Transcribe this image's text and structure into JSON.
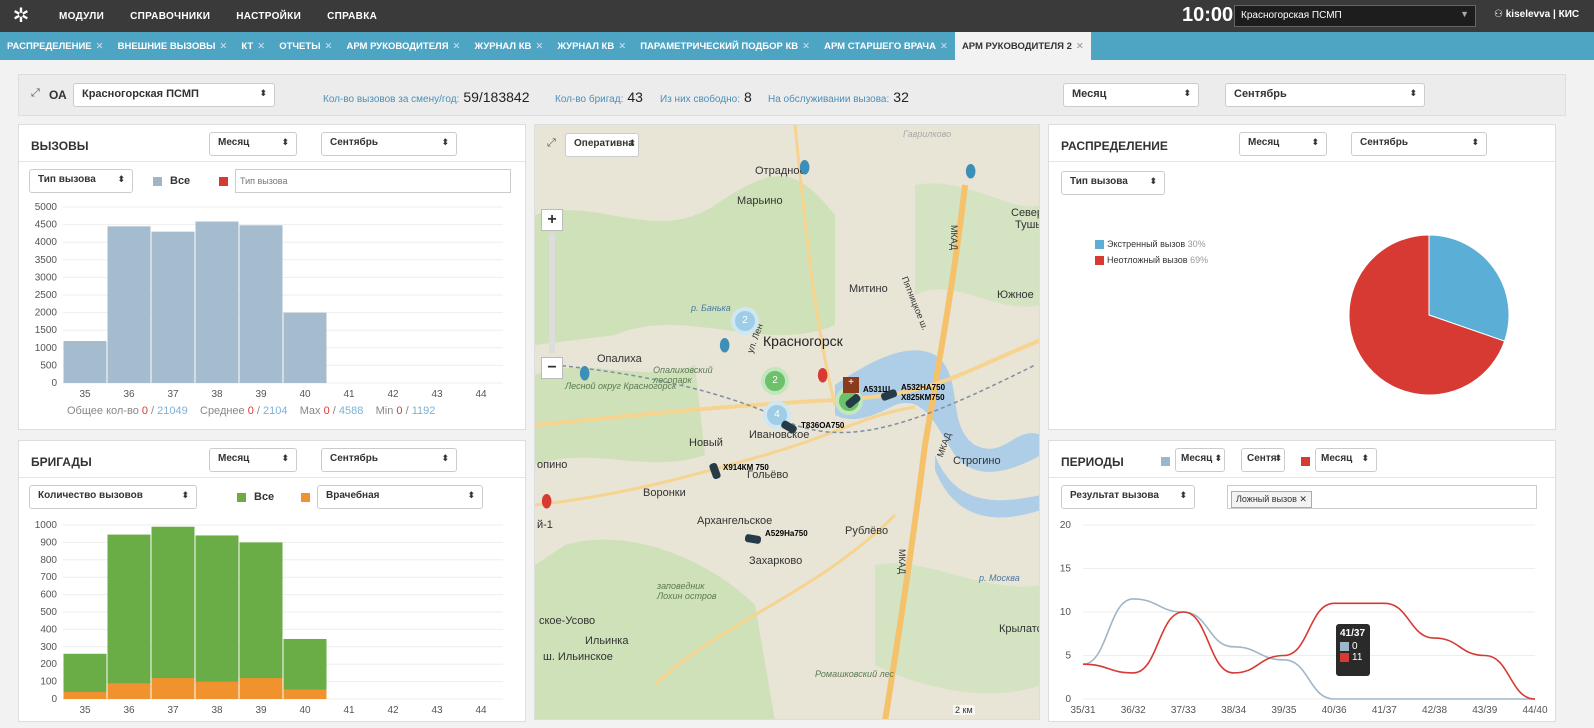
{
  "topbar": {
    "menu": [
      "МОДУЛИ",
      "СПРАВОЧНИКИ",
      "НАСТРОЙКИ",
      "СПРАВКА"
    ],
    "time": "10:00",
    "org": "Красногорская ПСМП",
    "user": "kiselevva | КИС"
  },
  "tabs": [
    "РАСПРЕДЕЛЕНИЕ",
    "ВНЕШНИЕ ВЫЗОВЫ",
    "КТ",
    "ОТЧЕТЫ",
    "АРМ РУКОВОДИТЕЛЯ",
    "ЖУРНАЛ КВ",
    "ЖУРНАЛ КВ",
    "ПАРАМЕТРИЧЕСКИЙ ПОДБОР КВ",
    "АРМ СТАРШЕГО ВРАЧА",
    "АРМ РУКОВОДИТЕЛЯ 2"
  ],
  "oabar": {
    "label": "ОА",
    "org": "Красногорская ПСМП",
    "calls_label": "Кол-во вызовов за смену/год:",
    "calls": "59/183842",
    "brigades_label": "Кол-во бригад:",
    "brigades": "43",
    "free_label": "Из них свободно:",
    "free": "8",
    "busy_label": "На обслуживании вызова:",
    "busy": "32",
    "period": "Месяц",
    "month": "Сентябрь"
  },
  "calls": {
    "title": "ВЫЗОВЫ",
    "period": "Месяц",
    "month": "Сентябрь",
    "type": "Тип вызова",
    "legend_all": "Все",
    "filter_placeholder": "Тип вызова",
    "summary": {
      "total_label": "Общее кол-во",
      "total_a": "0",
      "total_b": "21049",
      "avg_label": "Среднее",
      "avg_a": "0",
      "avg_b": "2104",
      "max_label": "Max",
      "max_a": "0",
      "max_b": "4588",
      "min_label": "Min",
      "min_a": "0",
      "min_b": "1192"
    }
  },
  "brigades": {
    "title": "БРИГАДЫ",
    "period": "Месяц",
    "month": "Сентябрь",
    "type": "Количество вызовов",
    "legend_all": "Все",
    "legend_doc": "Врачебная"
  },
  "map": {
    "mode": "Оперативна",
    "labels": {
      "otradnoe": "Отрадное",
      "marino": "Марьино",
      "sever": "Север",
      "tush": "Тушь",
      "mitino": "Митино",
      "yuzhnoe": "Южное",
      "krasnogorsk": "Красногорск",
      "opaliha": "Опалиха",
      "lesopark": "Опалиховский лесопарк",
      "okrug": "Лесной округ Красногорск",
      "banka": "р. Банька",
      "novy": "Новый",
      "ivanovskoe": "Ивановское",
      "golevo": "Гольёво",
      "voronki": "Воронки",
      "arkh": "Архангельское",
      "rublevo": "Рублёво",
      "zaharkovo": "Захарково",
      "zapoved": "заповедник Лохин остров",
      "usovo": "ское-Усово",
      "ilyinka": "Ильинка",
      "ilyinskoe": "ш. Ильинское",
      "strogino": "Строгино",
      "moskva": "р. Москва",
      "krylatsk": "Крылатс",
      "mkad1": "МКАД",
      "mkad2": "МКАД",
      "mkad3": "МКАД",
      "romash": "Ромашковский лес",
      "pinino": "опино",
      "piat": "Пятницкое ш.",
      "gavr": "Гаврилково",
      "scale": "2 км",
      "one": "й-1",
      "lenin": "ул. Лен"
    },
    "clusters": [
      "2",
      "2",
      "4"
    ],
    "cars": [
      "А531Ш",
      "А532НА750",
      "Х825КМ750",
      "Т836ОА750",
      "Х914КМ 750",
      "А529На750"
    ]
  },
  "distribution": {
    "title": "РАСПРЕДЕЛЕНИЕ",
    "period": "Месяц",
    "month": "Сентябрь",
    "type": "Тип вызова",
    "legend": [
      {
        "name": "Экстренный вызов",
        "pct": "30%",
        "color": "#5bafd6"
      },
      {
        "name": "Неотложный вызов",
        "pct": "69%",
        "color": "#d63a32"
      }
    ]
  },
  "periods": {
    "title": "ПЕРИОДЫ",
    "sel1": "Месяц",
    "sel2": "Сентя",
    "sel3": "Месяц",
    "type": "Результат вызова",
    "tag": "Ложный вызов",
    "tooltip": {
      "title": "41/37",
      "v1": "0",
      "v2": "11"
    }
  },
  "chart_data": [
    {
      "type": "bar",
      "title": "ВЫЗОВЫ",
      "categories": [
        "35",
        "36",
        "37",
        "38",
        "39",
        "40",
        "41",
        "42",
        "43",
        "44"
      ],
      "values": [
        1192,
        4450,
        4300,
        4588,
        4480,
        2000,
        0,
        0,
        0,
        0
      ],
      "ylim": [
        0,
        5000
      ],
      "yticks": [
        0,
        500,
        1000,
        1500,
        2000,
        2500,
        3000,
        3500,
        4000,
        4500,
        5000
      ]
    },
    {
      "type": "bar",
      "title": "БРИГАДЫ",
      "categories": [
        "35",
        "36",
        "37",
        "38",
        "39",
        "40",
        "41",
        "42",
        "43",
        "44"
      ],
      "series": [
        {
          "name": "Все",
          "values": [
            260,
            945,
            990,
            940,
            900,
            345,
            0,
            0,
            0,
            0
          ]
        },
        {
          "name": "Врачебная",
          "values": [
            40,
            90,
            120,
            100,
            120,
            55,
            0,
            0,
            0,
            0
          ]
        }
      ],
      "ylim": [
        0,
        1000
      ],
      "yticks": [
        0,
        100,
        200,
        300,
        400,
        500,
        600,
        700,
        800,
        900,
        1000
      ]
    },
    {
      "type": "pie",
      "title": "РАСПРЕДЕЛЕНИЕ",
      "labels": [
        "Экстренный вызов",
        "Неотложный вызов"
      ],
      "values": [
        30,
        69
      ]
    },
    {
      "type": "line",
      "title": "ПЕРИОДЫ",
      "categories": [
        "35/31",
        "36/32",
        "37/33",
        "38/34",
        "39/35",
        "40/36",
        "41/37",
        "42/38",
        "43/39",
        "44/40"
      ],
      "series": [
        {
          "values": [
            4,
            11.5,
            10,
            6,
            4.5,
            0,
            0,
            0,
            0,
            0
          ]
        },
        {
          "values": [
            4,
            3,
            10,
            3,
            5,
            11,
            11,
            7,
            5,
            0
          ]
        }
      ],
      "ylim": [
        0,
        20
      ],
      "yticks": [
        0,
        5,
        10,
        15,
        20
      ]
    }
  ]
}
